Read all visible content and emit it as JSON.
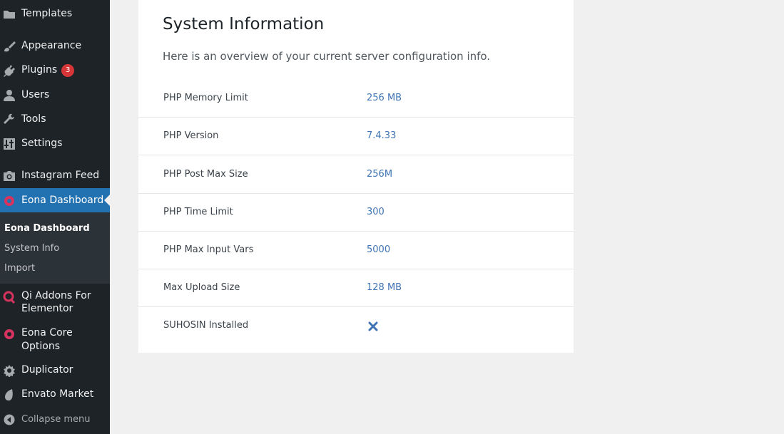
{
  "sidebar": {
    "items": [
      {
        "label": "Templates",
        "icon": "folder-icon"
      },
      {
        "label": "Appearance",
        "icon": "paintbrush-icon"
      },
      {
        "label": "Plugins",
        "icon": "plug-icon",
        "badge": "3"
      },
      {
        "label": "Users",
        "icon": "user-icon"
      },
      {
        "label": "Tools",
        "icon": "wrench-icon"
      },
      {
        "label": "Settings",
        "icon": "settings-icon"
      },
      {
        "label": "Instagram Feed",
        "icon": "camera-icon"
      },
      {
        "label": "Eona Dashboard",
        "icon": "eona-icon"
      },
      {
        "label": "Qi Addons For Elementor",
        "label_line1": "Qi Addons For",
        "label_line2": "Elementor",
        "icon": "qi-icon"
      },
      {
        "label": "Eona Core Options",
        "label_line1": "Eona Core",
        "label_line2": "Options",
        "icon": "eona-core-icon"
      },
      {
        "label": "Duplicator",
        "icon": "duplicator-icon"
      },
      {
        "label": "Envato Market",
        "icon": "leaf-icon"
      },
      {
        "label": "Collapse menu",
        "icon": "collapse-icon"
      }
    ],
    "submenu": [
      {
        "label": "Eona Dashboard"
      },
      {
        "label": "System Info"
      },
      {
        "label": "Import"
      }
    ]
  },
  "main": {
    "title": "System Information",
    "intro": "Here is an overview of your current server configuration info.",
    "rows": [
      {
        "key": "PHP Memory Limit",
        "value": "256 MB"
      },
      {
        "key": "PHP Version",
        "value": "7.4.33"
      },
      {
        "key": "PHP Post Max Size",
        "value": "256M"
      },
      {
        "key": "PHP Time Limit",
        "value": "300"
      },
      {
        "key": "PHP Max Input Vars",
        "value": "5000"
      },
      {
        "key": "Max Upload Size",
        "value": "128 MB"
      },
      {
        "key": "SUHOSIN Installed",
        "value_icon": "cross-icon"
      }
    ]
  },
  "colors": {
    "sidebar_bg": "#1d2327",
    "active_bg": "#2271b1",
    "submenu_bg": "#2c3338",
    "badge": "#d63638",
    "value_text": "#3f73b3",
    "eona_accent": "#d6335e"
  }
}
